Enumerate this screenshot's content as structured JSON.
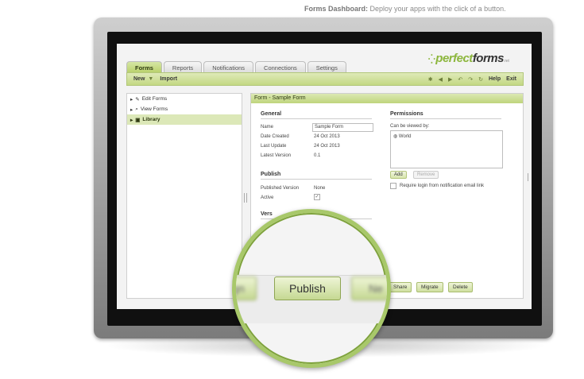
{
  "caption": {
    "bold": "Forms Dashboard:",
    "rest": " Deploy your apps with the click of a button."
  },
  "logo": {
    "text_perfect": "perfect",
    "text_forms": "forms",
    "suffix": ".net"
  },
  "tabs": [
    "Forms",
    "Reports",
    "Notifications",
    "Connections",
    "Settings"
  ],
  "toolbar": {
    "new": "New",
    "import": "Import",
    "help": "Help",
    "exit": "Exit"
  },
  "tree": [
    {
      "label": "Edit Forms",
      "icon": "pencil-icon"
    },
    {
      "label": "View Forms",
      "icon": "magnifier-icon"
    },
    {
      "label": "Library",
      "icon": "folder-icon"
    }
  ],
  "panel": {
    "title": "Form - Sample Form",
    "general": {
      "heading": "General",
      "name_label": "Name",
      "name_value": "Sample Form",
      "date_created_label": "Date Created",
      "date_created_value": "24 Oct 2013",
      "last_update_label": "Last Update",
      "last_update_value": "24 Oct 2013",
      "latest_version_label": "Latest Version",
      "latest_version_value": "0.1"
    },
    "publish": {
      "heading": "Publish",
      "published_version_label": "Published Version",
      "published_version_value": "None",
      "active_label": "Active"
    },
    "versions_heading": "Vers",
    "permissions": {
      "heading": "Permissions",
      "viewed_by_label": "Can be viewed by:",
      "items": [
        "World"
      ],
      "add": "Add",
      "remove": "Remove",
      "require_login": "Require login from notification email link"
    }
  },
  "footer_buttons": [
    "Share",
    "Migrate",
    "Delete"
  ],
  "magnifier": {
    "left_fragment": "gn",
    "publish": "Publish",
    "right_fragment": "Ne"
  }
}
